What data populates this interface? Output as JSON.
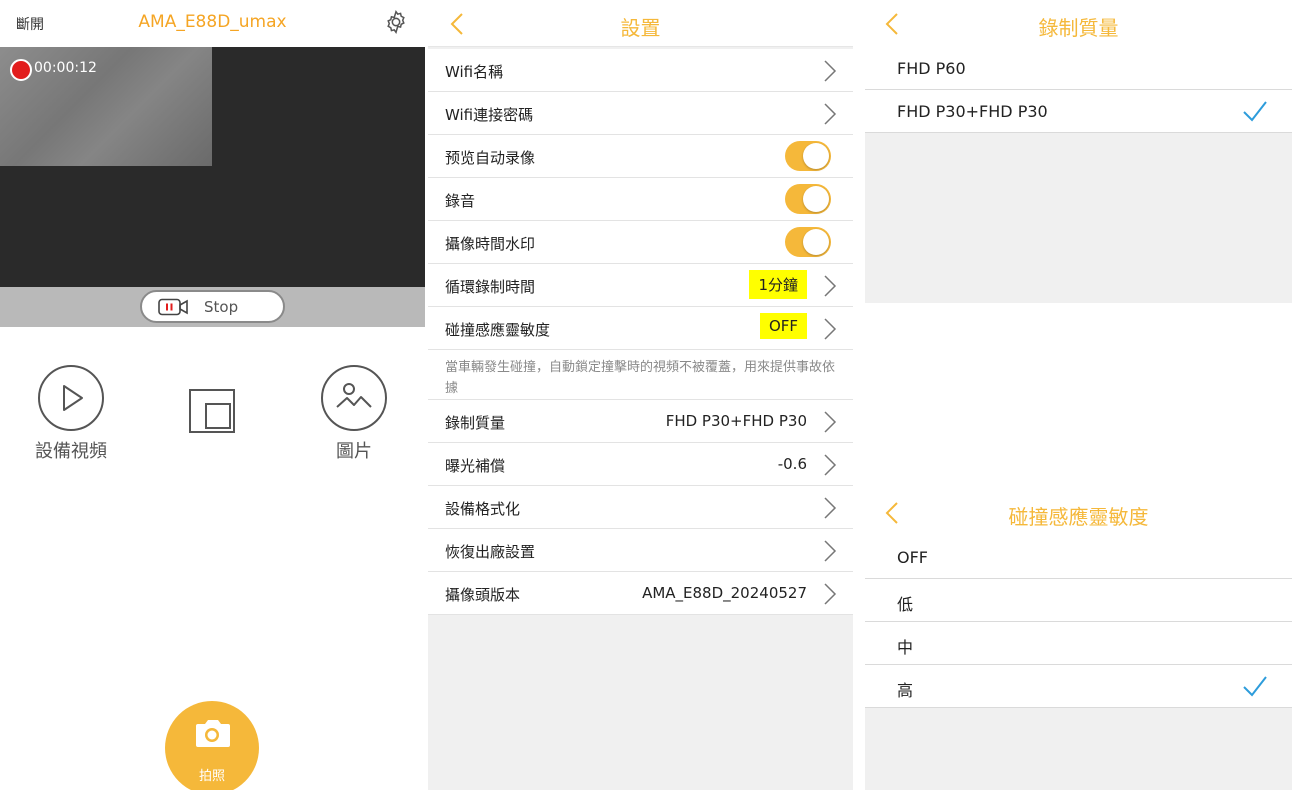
{
  "camera": {
    "disconnect_label": "斷開",
    "device_title": "AMA_E88D_umax",
    "rec_time": "00:00:12",
    "stop_label": "Stop",
    "nav": [
      {
        "label": "設備視頻",
        "icon": "play-icon"
      },
      {
        "label": "",
        "icon": "picture-in-picture-icon"
      },
      {
        "label": "圖片",
        "icon": "gallery-icon"
      }
    ],
    "shutter_label": "拍照",
    "colors": {
      "accent": "#f5a524",
      "shutter": "#f5b83a",
      "video_bg": "#2a2a2a",
      "rec": "#e21d1d"
    }
  },
  "settings": {
    "title": "設置",
    "rows": [
      {
        "label": "Wifi名稱",
        "type": "link"
      },
      {
        "label": "Wifi連接密碼",
        "type": "link"
      },
      {
        "label": "预览自动录像",
        "type": "toggle",
        "on": true
      },
      {
        "label": "錄音",
        "type": "toggle",
        "on": true
      },
      {
        "label": "攝像時間水印",
        "type": "toggle",
        "on": true
      },
      {
        "label": "循環錄制時間",
        "type": "value",
        "value": "1分鐘",
        "highlight": true
      },
      {
        "label": "碰撞感應靈敏度",
        "type": "value",
        "value": "OFF",
        "highlight": true
      }
    ],
    "note": "當車輛發生碰撞，自動鎖定撞擊時的視頻不被覆蓋，用來提供事故依據",
    "rows2": [
      {
        "label": "錄制質量",
        "value": "FHD P30+FHD P30"
      },
      {
        "label": "曝光補償",
        "value": "-0.6"
      },
      {
        "label": "設備格式化",
        "value": ""
      },
      {
        "label": "恢復出廠設置",
        "value": ""
      },
      {
        "label": "攝像頭版本",
        "value": "AMA_E88D_20240527"
      }
    ],
    "colors": {
      "toggle_on": "#f5b83a",
      "highlight": "#ffff00"
    }
  },
  "quality": {
    "title": "錄制質量",
    "options": [
      {
        "label": "FHD P60",
        "selected": false
      },
      {
        "label": "FHD P30+FHD P30",
        "selected": true
      }
    ]
  },
  "collision": {
    "title": "碰撞感應靈敏度",
    "options": [
      {
        "label": "OFF",
        "selected": false
      },
      {
        "label": "低",
        "selected": false
      },
      {
        "label": "中",
        "selected": false
      },
      {
        "label": "高",
        "selected": true
      }
    ],
    "colors": {
      "check": "#2d9cdb"
    }
  }
}
